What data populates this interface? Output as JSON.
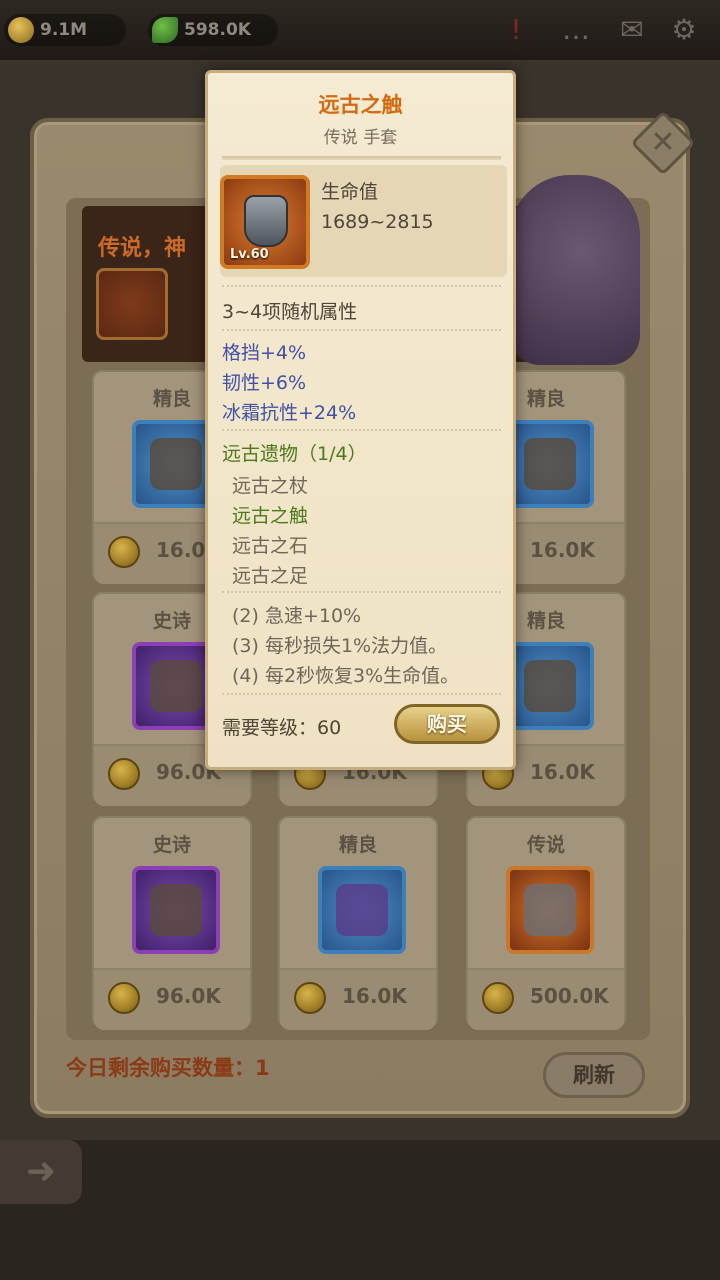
{
  "topbar": {
    "gold": "9.1M",
    "gems": "598.0K",
    "icons": [
      "alert-icon",
      "chat-icon",
      "mail-icon",
      "settings-icon"
    ]
  },
  "banner": {
    "title": "传说，神"
  },
  "shop": {
    "cards": [
      {
        "rarity": "精良",
        "price": "16.0K",
        "tier": "fine",
        "icon": "mask-icon"
      },
      {
        "rarity": "",
        "price": "",
        "tier": "fine",
        "icon": ""
      },
      {
        "rarity": "精良",
        "price": "16.0K",
        "tier": "fine",
        "icon": "boots-icon"
      },
      {
        "rarity": "史诗",
        "price": "96.0K",
        "tier": "epic",
        "icon": "helmet-icon"
      },
      {
        "rarity": "",
        "price": "16.0K",
        "tier": "fine",
        "icon": ""
      },
      {
        "rarity": "精良",
        "price": "16.0K",
        "tier": "fine",
        "icon": "hood-icon"
      },
      {
        "rarity": "史诗",
        "price": "96.0K",
        "tier": "epic",
        "icon": "staff-icon"
      },
      {
        "rarity": "精良",
        "price": "16.0K",
        "tier": "fine",
        "icon": "glove-icon"
      },
      {
        "rarity": "传说",
        "price": "500.0K",
        "tier": "legendary",
        "icon": "gauntlet-icon"
      }
    ],
    "remaining": "今日剩余购买数量：1",
    "refresh_label": "刷新"
  },
  "tooltip": {
    "title": "远古之触",
    "subtitle": "传说 手套",
    "level": "Lv.60",
    "stat_name": "生命值",
    "stat_value": "1689~2815",
    "random_attrs": "3~4项随机属性",
    "attrs": [
      "格挡+4%",
      "韧性+6%",
      "冰霜抗性+24%"
    ],
    "set_name": "远古遗物（1/4）",
    "set_items": [
      {
        "name": "远古之杖",
        "owned": false
      },
      {
        "name": "远古之触",
        "owned": true
      },
      {
        "name": "远古之石",
        "owned": false
      },
      {
        "name": "远古之足",
        "owned": false
      }
    ],
    "set_bonuses": [
      "(2) 急速+10%",
      "(3) 每秒损失1%法力值。",
      "(4) 每2秒恢复3%生命值。"
    ],
    "required_level": "需要等级：60",
    "buy_label": "购买"
  },
  "colors": {
    "title_orange": "#d46a12",
    "attr_blue": "#4152a6",
    "set_green": "#4c7a19",
    "fine_blue": "#3d7fb8",
    "epic_purple": "#8d3fb4",
    "legendary_orange": "#c9772a"
  }
}
